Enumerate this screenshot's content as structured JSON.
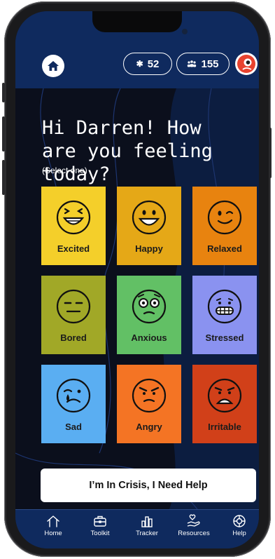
{
  "header": {
    "stars_count": "52",
    "community_count": "155",
    "star_glyph": "✱",
    "community_glyph": "ඞ",
    "accent_color": "#0f2a5e"
  },
  "main": {
    "greeting": "Hi Darren! How are you feeling today?",
    "hint": "(Select one)",
    "moods": [
      {
        "label": "Excited",
        "color": "#f4cf2a",
        "icon": "grinning-squint-icon"
      },
      {
        "label": "Happy",
        "color": "#e5a817",
        "icon": "smile-icon"
      },
      {
        "label": "Relaxed",
        "color": "#e8830f",
        "icon": "wink-icon"
      },
      {
        "label": "Bored",
        "color": "#a1a827",
        "icon": "neutral-icon"
      },
      {
        "label": "Anxious",
        "color": "#62c065",
        "icon": "wide-eyed-icon"
      },
      {
        "label": "Stressed",
        "color": "#8a92f0",
        "icon": "grimace-icon"
      },
      {
        "label": "Sad",
        "color": "#5aaef2",
        "icon": "crying-icon"
      },
      {
        "label": "Angry",
        "color": "#f47424",
        "icon": "angry-icon"
      },
      {
        "label": "Irritable",
        "color": "#d14019",
        "icon": "frown-icon"
      }
    ],
    "crisis_label": "I’m In Crisis, I Need Help"
  },
  "nav": {
    "items": [
      {
        "label": "Home",
        "icon": "house-icon"
      },
      {
        "label": "Toolkit",
        "icon": "briefcase-icon"
      },
      {
        "label": "Tracker",
        "icon": "bar-chart-icon"
      },
      {
        "label": "Resources",
        "icon": "hand-heart-icon"
      },
      {
        "label": "Help",
        "icon": "lifebuoy-icon"
      }
    ]
  }
}
